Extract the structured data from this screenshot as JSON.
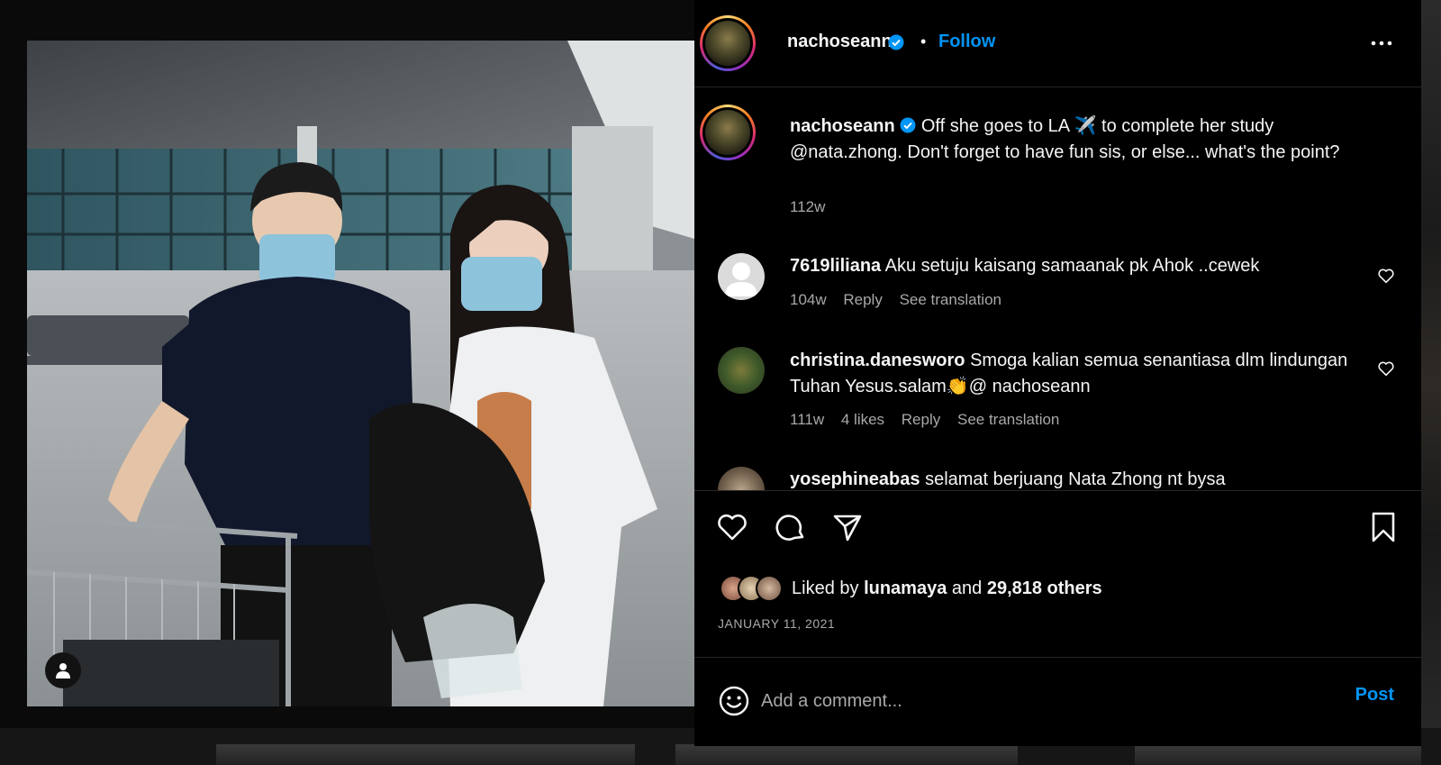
{
  "post": {
    "username": "nachoseann",
    "follow_label": "Follow",
    "dot": "•",
    "caption_text": "Off she goes to LA ✈️  to complete her study @nata.zhong. Don't forget to have fun sis, or else... what's the point?",
    "caption_age": "112w"
  },
  "comments": [
    {
      "username": "7619liliana",
      "text": "Aku setuju kaisang samaanak pk Ahok ..cewek",
      "age": "104w",
      "likes": "",
      "reply": "Reply",
      "translate": "See translation"
    },
    {
      "username": "christina.danesworo",
      "text": "Smoga kalian semua senantiasa dlm lindungan Tuhan Yesus.salam👏@ nachoseann",
      "age": "111w",
      "likes": "4 likes",
      "reply": "Reply",
      "translate": "See translation"
    },
    {
      "username": "yosephineabas",
      "text": "selamat berjuang Nata Zhong nt bysa"
    }
  ],
  "likes": {
    "prefix": "Liked by",
    "user": "lunamaya",
    "middle": "and",
    "count": "29,818 others"
  },
  "date": "JANUARY 11, 2021",
  "comment_box": {
    "placeholder": "Add a comment...",
    "post_label": "Post"
  },
  "colors": {
    "accent": "#0095f6",
    "panel_bg": "#000000",
    "muted": "#a8a8a8",
    "divider": "#262626"
  },
  "icons": [
    "verified-badge-icon",
    "more-options-icon",
    "heart-icon",
    "comment-icon",
    "share-icon",
    "bookmark-icon",
    "emoji-icon",
    "user-tag-icon"
  ]
}
